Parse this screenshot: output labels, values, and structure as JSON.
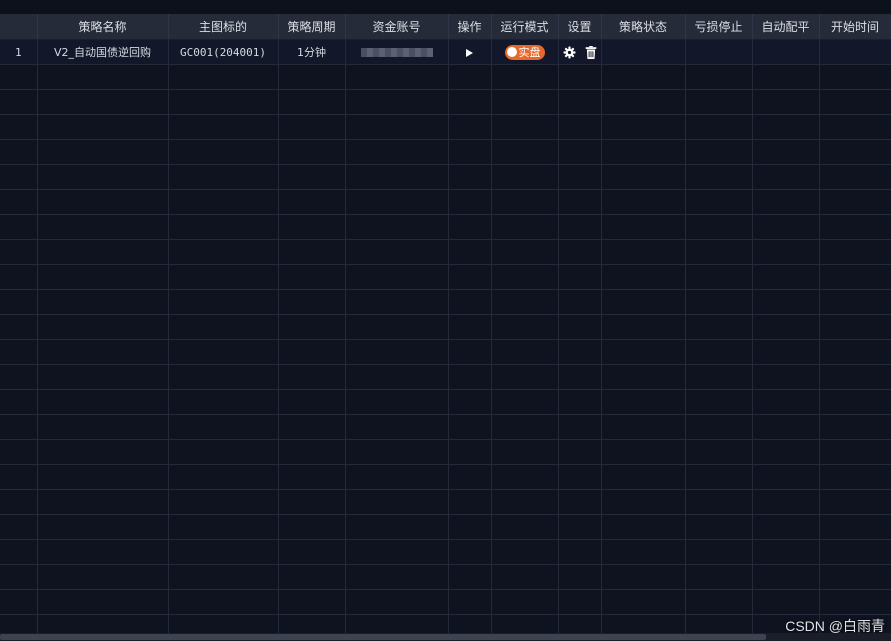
{
  "table": {
    "columns": [
      "",
      "策略名称",
      "主图标的",
      "策略周期",
      "资金账号",
      "操作",
      "运行模式",
      "设置",
      "策略状态",
      "亏损停止",
      "自动配平",
      "开始时间"
    ],
    "rows": [
      {
        "index": "1",
        "name": "V2_自动国债逆回购",
        "symbol": "GC001(204001)",
        "period": "1分钟",
        "run_mode": "实盘"
      }
    ]
  },
  "icons": {
    "operation": "play-icon",
    "settings": "gear-icon",
    "delete": "trash-icon"
  },
  "colors": {
    "background": "#0f1320",
    "header": "#262b39",
    "run_mode_toggle": "#e8672a"
  },
  "watermark": "CSDN @白雨青"
}
